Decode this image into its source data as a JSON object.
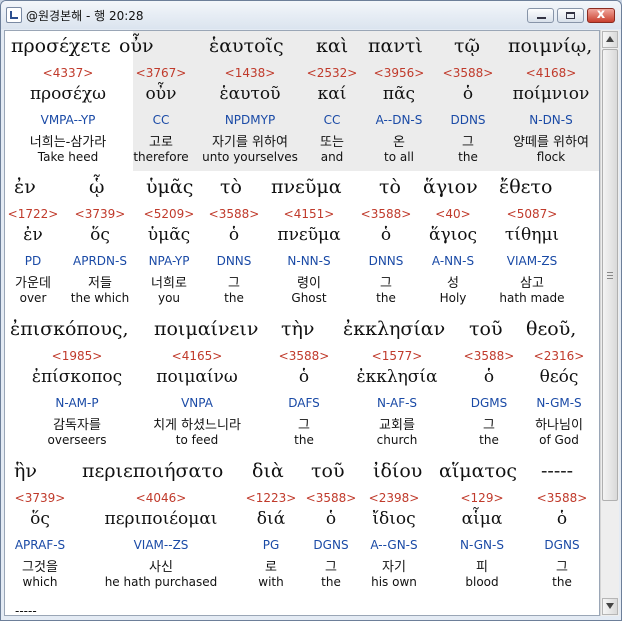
{
  "window": {
    "title": "@원경본해 - 행 20:28",
    "close_label": "x"
  },
  "blocks": [
    {
      "words": [
        {
          "greek": "προσέχετε",
          "num": "<4337>",
          "lex": "προσέχω",
          "parse": "VMPA--YP",
          "kr": "너희는-삼가라",
          "en": "Take heed"
        },
        {
          "greek": "οὖν",
          "num": "<3767>",
          "lex": "οὖν",
          "parse": "CC",
          "kr": "고로",
          "en": "therefore"
        },
        {
          "greek": "ἑαυτοῖς",
          "num": "<1438>",
          "lex": "ἑαυτοῦ",
          "parse": "NPDMYP",
          "kr": "자기를 위하여",
          "en": "unto yourselves"
        },
        {
          "greek": "καὶ",
          "num": "<2532>",
          "lex": "καί",
          "parse": "CC",
          "kr": "또는",
          "en": "and"
        },
        {
          "greek": "παντὶ",
          "num": "<3956>",
          "lex": "πᾶς",
          "parse": "A--DN-S",
          "kr": "온",
          "en": "to all"
        },
        {
          "greek": "τῷ",
          "num": "<3588>",
          "lex": "ὁ",
          "parse": "DDNS",
          "kr": "그",
          "en": "the"
        },
        {
          "greek": "ποιμνίῳ,",
          "num": "<4168>",
          "lex": "ποίμνιον",
          "parse": "N-DN-S",
          "kr": "양떼를 위하여",
          "en": "flock"
        }
      ]
    },
    {
      "words": [
        {
          "greek": "ἐν",
          "num": "<1722>",
          "lex": "ἐν",
          "parse": "PD",
          "kr": "가운데",
          "en": "over"
        },
        {
          "greek": "ᾧ",
          "num": "<3739>",
          "lex": "ὅς",
          "parse": "APRDN-S",
          "kr": "저들",
          "en": "the which"
        },
        {
          "greek": "ὑμᾶς",
          "num": "<5209>",
          "lex": "ὑμᾶς",
          "parse": "NPA-YP",
          "kr": "너희로",
          "en": "you"
        },
        {
          "greek": "τὸ",
          "num": "<3588>",
          "lex": "ὁ",
          "parse": "DNNS",
          "kr": "그",
          "en": "the"
        },
        {
          "greek": "πνεῦμα",
          "num": "<4151>",
          "lex": "πνεῦμα",
          "parse": "N-NN-S",
          "kr": "령이",
          "en": "Ghost"
        },
        {
          "greek": "τὸ",
          "num": "<3588>",
          "lex": "ὁ",
          "parse": "DNNS",
          "kr": "그",
          "en": "the"
        },
        {
          "greek": "ἅγιον",
          "num": "<40>",
          "lex": "ἅγιος",
          "parse": "A-NN-S",
          "kr": "성",
          "en": "Holy"
        },
        {
          "greek": "ἔθετο",
          "num": "<5087>",
          "lex": "τίθημι",
          "parse": "VIAM-ZS",
          "kr": "삼고",
          "en": "hath made"
        }
      ]
    },
    {
      "words": [
        {
          "greek": "ἐπισκόπους,",
          "num": "<1985>",
          "lex": "ἐπίσκοπος",
          "parse": "N-AM-P",
          "kr": "감독자를",
          "en": "overseers"
        },
        {
          "greek": "ποιμαίνειν",
          "num": "<4165>",
          "lex": "ποιμαίνω",
          "parse": "VNPA",
          "kr": "치게 하셨느니라",
          "en": "to feed"
        },
        {
          "greek": "τὴν",
          "num": "<3588>",
          "lex": "ὁ",
          "parse": "DAFS",
          "kr": "그",
          "en": "the"
        },
        {
          "greek": "ἐκκλησίαν",
          "num": "<1577>",
          "lex": "ἐκκλησία",
          "parse": "N-AF-S",
          "kr": "교회를",
          "en": "church"
        },
        {
          "greek": "τοῦ",
          "num": "<3588>",
          "lex": "ὁ",
          "parse": "DGMS",
          "kr": "그",
          "en": "the"
        },
        {
          "greek": "θεοῦ,",
          "num": "<2316>",
          "lex": "θεός",
          "parse": "N-GM-S",
          "kr": "하나님이",
          "en": "of God"
        }
      ]
    },
    {
      "words": [
        {
          "greek": "ἣν",
          "num": "<3739>",
          "lex": "ὅς",
          "parse": "APRAF-S",
          "kr": "그것을",
          "en": "which"
        },
        {
          "greek": "περιεποιήσατο",
          "num": "<4046>",
          "lex": "περιποιέομαι",
          "parse": "VIAM--ZS",
          "kr": "사신",
          "en": "he hath purchased"
        },
        {
          "greek": "διὰ",
          "num": "<1223>",
          "lex": "διά",
          "parse": "PG",
          "kr": "로",
          "en": "with"
        },
        {
          "greek": "τοῦ",
          "num": "<3588>",
          "lex": "ὁ",
          "parse": "DGNS",
          "kr": "그",
          "en": "the"
        },
        {
          "greek": "ἰδίου",
          "num": "<2398>",
          "lex": "ἴδιος",
          "parse": "A--GN-S",
          "kr": "자기",
          "en": "his own"
        },
        {
          "greek": "αἵματος",
          "num": "<129>",
          "lex": "αἷμα",
          "parse": "N-GN-S",
          "kr": "피",
          "en": "blood"
        },
        {
          "greek": "-----",
          "num": "<3588>",
          "lex": "ὁ",
          "parse": "DGNS",
          "kr": "그",
          "en": "the"
        }
      ]
    }
  ],
  "footer": {
    "end_marker": "-----"
  }
}
